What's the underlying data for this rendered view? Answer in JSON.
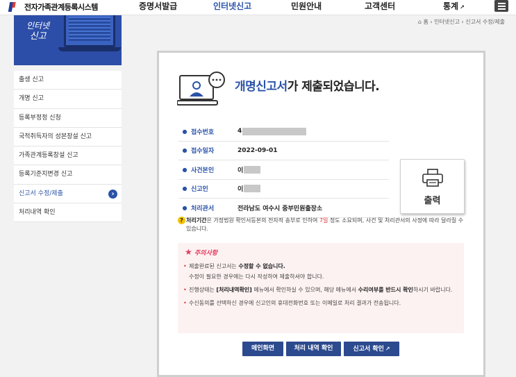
{
  "header": {
    "site_name": "전자가족관계등록시스템",
    "nav": [
      {
        "label": "증명서발급"
      },
      {
        "label": "인터넷신고"
      },
      {
        "label": "민원안내"
      },
      {
        "label": "고객센터"
      },
      {
        "label": "통계"
      }
    ]
  },
  "banner": {
    "line1": "인터넷",
    "line2": "신고"
  },
  "sidebar": {
    "items": [
      {
        "label": "출생 신고"
      },
      {
        "label": "개명 신고"
      },
      {
        "label": "등록부정정 신청"
      },
      {
        "label": "국적취득자의 성본창설 신고"
      },
      {
        "label": "가족관계등록창설 신고"
      },
      {
        "label": "등록기준지변경 신고"
      },
      {
        "label": "신고서 수정/제출"
      },
      {
        "label": "처리내역 확인"
      }
    ]
  },
  "breadcrumb": {
    "home": "홈",
    "section": "인터넷신고",
    "current": "신고서 수정/제출"
  },
  "result": {
    "title_em": "개명신고서",
    "title_rest": "가 제출되었습니다."
  },
  "info": {
    "rows": [
      {
        "label": "접수번호",
        "value": "4"
      },
      {
        "label": "접수일자",
        "value": "2022-09-01"
      },
      {
        "label": "사건본인",
        "value": "이"
      },
      {
        "label": "신고인",
        "value": "이"
      },
      {
        "label": "처리관서",
        "value": "전라남도 여수시 중부민원출장소"
      }
    ]
  },
  "print": {
    "label": "출력"
  },
  "notice": {
    "strong": "처리기간",
    "text1": "은 가정법원 확인서등본의 전자적 송부로 인하여 ",
    "days": "7일",
    "text2": " 정도 소요되며, 사건 및 처리관서의 사정에 따라 달라질 수 있습니다."
  },
  "caution": {
    "title": "주의사항",
    "item1_text": "제출완료된 신고서는 ",
    "item1_strong": "수정할 수 없습니다.",
    "item1_line2": "수정이 필요한 경우에는 다시 작성하여 제출하셔야 합니다.",
    "item2_a": "진행상태는 ",
    "item2_b": "[처리내역확인]",
    "item2_c": " 메뉴에서 확인하실 수 있으며, 해당 메뉴에서 ",
    "item2_d": "수리여부를 반드시 확인",
    "item2_e": "하시기 바랍니다.",
    "item3": "수신동의를 선택하신 경우에 신고인의 휴대전화번호 또는 이메일로 처리 결과가 전송됩니다."
  },
  "buttons": {
    "main": "메인화면",
    "history": "처리 내역 확인",
    "check": "신고서 확인"
  },
  "colors": {
    "accent": "#2a52a8",
    "button": "#2c4a8e",
    "caution_bg": "#fdf2f2",
    "caution_title": "#e23b60"
  }
}
